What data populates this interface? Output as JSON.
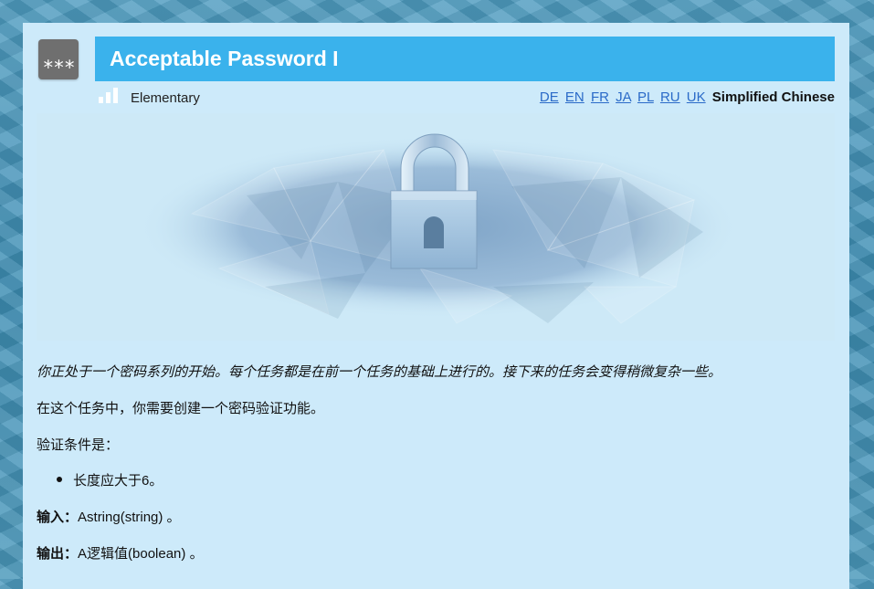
{
  "task": {
    "icon_text": "***",
    "title": "Acceptable Password I",
    "difficulty": "Elementary"
  },
  "languages": {
    "links": [
      "DE",
      "EN",
      "FR",
      "JA",
      "PL",
      "RU",
      "UK"
    ],
    "current": "Simplified Chinese"
  },
  "banner": {
    "icon": "padlock-icon"
  },
  "description": {
    "intro": "你正处于一个密码系列的开始。每个任务都是在前一个任务的基础上进行的。接下来的任务会变得稍微复杂一些。",
    "task_text": "在这个任务中，你需要创建一个密码验证功能。",
    "conditions_label": "验证条件是：",
    "conditions": [
      "长度应大于6。"
    ],
    "input_label": "输入：",
    "input_text": "Astring(string) 。",
    "output_label": "输出：",
    "output_text": "A逻辑值(boolean) 。"
  },
  "colors": {
    "title_bar": "#3ab2ec",
    "panel": "#cdeafa",
    "link": "#2a6ac8",
    "icon_bg": "#6f6f6f"
  }
}
